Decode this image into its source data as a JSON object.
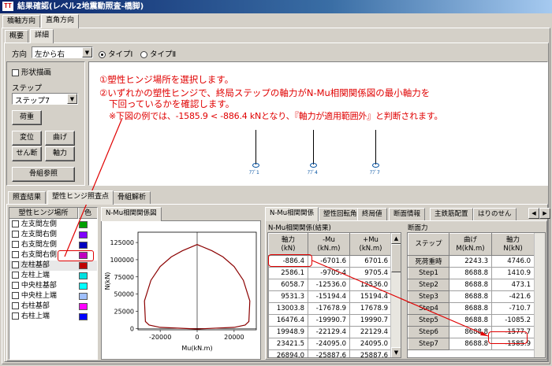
{
  "window": {
    "title": "結果確認(レベル2地震動照査-橋脚)",
    "icon_text": "TT"
  },
  "top_tabs": [
    "橋軸方向",
    "直角方向"
  ],
  "sub_tabs": [
    "概要",
    "詳細"
  ],
  "direction": {
    "label": "方向",
    "value": "左から右",
    "options": [
      "タイプⅠ",
      "タイプⅡ"
    ],
    "selected": 0
  },
  "left_panel": {
    "shape_checkbox": "形状描画",
    "step_label": "ステップ",
    "step_value": "ステップ7",
    "buttons": [
      "荷重",
      "変位",
      "曲げ",
      "せん断",
      "軸力",
      "骨組参照"
    ]
  },
  "annotation": {
    "line1": "①塑性ヒンジ場所を選択します。",
    "line2": "②いずれかの塑性ヒンジで、終局ステップの軸力がN-Mu相関関係図の最小軸力を",
    "line3": "下回っているかを確認します。",
    "line4": "※下図の例では、-1585.9 < -886.4 kNとなり、『軸力が適用範囲外』と判断されます。"
  },
  "frame_labels": [
    "ｱﾌﾞ1",
    "ｱﾌﾞ4",
    "ｱﾌﾞ7"
  ],
  "bottom_tabs": [
    "照査結果",
    "塑性ヒンジ照査点",
    "骨組解析"
  ],
  "hinge_list": {
    "headers": [
      "塑性ヒンジ場所",
      "色"
    ],
    "items": [
      {
        "label": "左支間左側",
        "color": "#00a000"
      },
      {
        "label": "左支間右側",
        "color": "#8000ff"
      },
      {
        "label": "右支間左側",
        "color": "#0000c0"
      },
      {
        "label": "右支間右側",
        "color": "#c000c0"
      },
      {
        "label": "左柱基部",
        "color": "#c00000"
      },
      {
        "label": "左柱上端",
        "color": "#00e0e0"
      },
      {
        "label": "中央柱基部",
        "color": "#00ffff"
      },
      {
        "label": "中央柱上端",
        "color": "#a0c0ff"
      },
      {
        "label": "右柱基部",
        "color": "#ff00ff"
      },
      {
        "label": "右柱上端",
        "color": "#0000ff"
      }
    ]
  },
  "graph_tab": "N-Mu相関関係図",
  "chart_data": {
    "type": "line",
    "title": "",
    "xlabel": "Mu(kN.m)",
    "ylabel": "N(kN)",
    "x_ticks": [
      "-20000",
      "0",
      "20000"
    ],
    "y_ticks": [
      "125000",
      "100000",
      "75000",
      "50000",
      "25000",
      "0"
    ],
    "xlim": [
      -32000,
      32000
    ],
    "ylim": [
      -2000,
      140000
    ],
    "series": [
      {
        "color": "#8b0000",
        "x": [
          0,
          20000,
          26000,
          28000,
          28500,
          25000,
          20000,
          14000,
          8000,
          0,
          -8000,
          -14000,
          -20000,
          -25000,
          -28500,
          -28000,
          -26000,
          -20000,
          0
        ],
        "y": [
          -886.4,
          1500,
          5000,
          10000,
          40000,
          70000,
          90000,
          104000,
          113000,
          122000,
          113000,
          104000,
          90000,
          70000,
          40000,
          10000,
          5000,
          1500,
          -886.4
        ]
      }
    ]
  },
  "right_tabs": [
    "N-Mu相関関係",
    "塑性回転角",
    "終局値",
    "断面情報",
    "主鉄筋配置",
    "はりのせん"
  ],
  "nmu_table": {
    "caption": "N-Mu相関関係(結果)",
    "headers": [
      "軸力\n(kN)",
      "-Mu\n(kN.m)",
      "+Mu\n(kN.m)"
    ],
    "rows": [
      [
        "-886.4",
        "-6701.6",
        "6701.6"
      ],
      [
        "2586.1",
        "-9705.4",
        "9705.4"
      ],
      [
        "6058.7",
        "-12536.0",
        "12536.0"
      ],
      [
        "9531.3",
        "-15194.4",
        "15194.4"
      ],
      [
        "13003.8",
        "-17678.9",
        "17678.9"
      ],
      [
        "16476.4",
        "-19990.7",
        "19990.7"
      ],
      [
        "19948.9",
        "-22129.4",
        "22129.4"
      ],
      [
        "23421.5",
        "-24095.0",
        "24095.0"
      ],
      [
        "26894.0",
        "-25887.6",
        "25887.6"
      ]
    ]
  },
  "section_table": {
    "caption": "断面力",
    "headers": [
      "ステップ",
      "曲げ\nM(kN.m)",
      "軸力\nN(kN)"
    ],
    "rows": [
      [
        "死荷重時",
        "2243.3",
        "4746.0"
      ],
      [
        "Step1",
        "8688.8",
        "1410.9"
      ],
      [
        "Step2",
        "8688.8",
        "473.1"
      ],
      [
        "Step3",
        "8688.8",
        "-421.6"
      ],
      [
        "Step4",
        "8688.8",
        "-710.7"
      ],
      [
        "Step5",
        "8688.8",
        "-1085.2"
      ],
      [
        "Step6",
        "8688.8",
        "-1577.7"
      ],
      [
        "Step7",
        "8688.8",
        "-1585.9"
      ]
    ]
  }
}
